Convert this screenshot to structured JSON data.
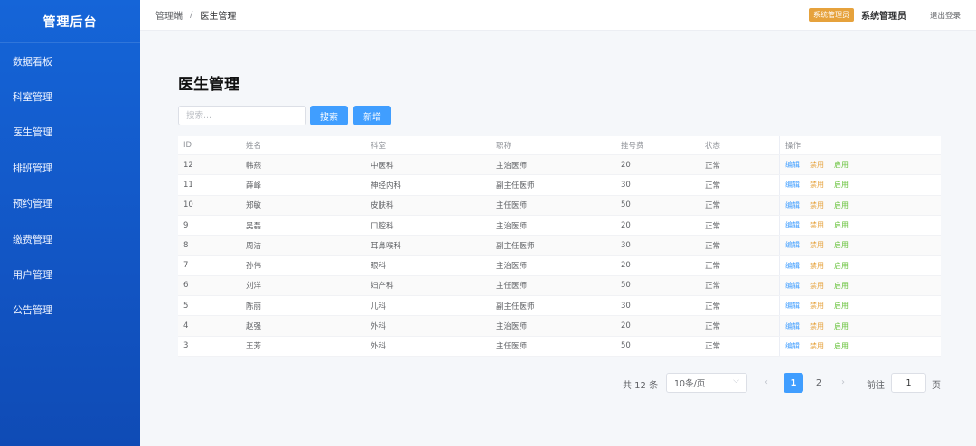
{
  "sidebar": {
    "brand": "管理后台",
    "items": [
      {
        "label": "数据看板"
      },
      {
        "label": "科室管理"
      },
      {
        "label": "医生管理"
      },
      {
        "label": "排班管理"
      },
      {
        "label": "预约管理"
      },
      {
        "label": "缴费管理"
      },
      {
        "label": "用户管理"
      },
      {
        "label": "公告管理"
      }
    ]
  },
  "header": {
    "breadcrumb": [
      "管理端",
      "医生管理"
    ],
    "separator": "/",
    "role_tag": "系统管理员",
    "admin_name": "系统管理员",
    "logout": "退出登录"
  },
  "main": {
    "title": "医生管理",
    "search": {
      "placeholder": "搜索...",
      "value": ""
    },
    "search_button": "搜索",
    "add_button": "新增"
  },
  "table": {
    "columns": [
      "ID",
      "姓名",
      "科室",
      "职称",
      "挂号费",
      "状态",
      "操作"
    ],
    "actions": {
      "edit": "编辑",
      "disable": "禁用",
      "enable": "启用"
    },
    "rows": [
      {
        "id": "12",
        "name": "韩燕",
        "dept": "中医科",
        "title": "主治医师",
        "fee": "20",
        "status": "正常"
      },
      {
        "id": "11",
        "name": "薛峰",
        "dept": "神经内科",
        "title": "副主任医师",
        "fee": "30",
        "status": "正常"
      },
      {
        "id": "10",
        "name": "郑敏",
        "dept": "皮肤科",
        "title": "主任医师",
        "fee": "50",
        "status": "正常"
      },
      {
        "id": "9",
        "name": "吴磊",
        "dept": "口腔科",
        "title": "主治医师",
        "fee": "20",
        "status": "正常"
      },
      {
        "id": "8",
        "name": "周洁",
        "dept": "耳鼻喉科",
        "title": "副主任医师",
        "fee": "30",
        "status": "正常"
      },
      {
        "id": "7",
        "name": "孙伟",
        "dept": "眼科",
        "title": "主治医师",
        "fee": "20",
        "status": "正常"
      },
      {
        "id": "6",
        "name": "刘洋",
        "dept": "妇产科",
        "title": "主任医师",
        "fee": "50",
        "status": "正常"
      },
      {
        "id": "5",
        "name": "陈丽",
        "dept": "儿科",
        "title": "副主任医师",
        "fee": "30",
        "status": "正常"
      },
      {
        "id": "4",
        "name": "赵强",
        "dept": "外科",
        "title": "主治医师",
        "fee": "20",
        "status": "正常"
      },
      {
        "id": "3",
        "name": "王芳",
        "dept": "外科",
        "title": "主任医师",
        "fee": "50",
        "status": "正常"
      }
    ]
  },
  "pagination": {
    "total": "共 12 条",
    "page_size": "10条/页",
    "prev": "‹",
    "next": "›",
    "pages": [
      "1",
      "2"
    ],
    "current_page": "1",
    "goto_label": "前往",
    "goto_value": "1",
    "page_suffix": "页"
  },
  "colors": {
    "sidebar": "#1565d8",
    "primary": "#409eff",
    "warning": "#e6a23c",
    "success": "#67c23a"
  }
}
